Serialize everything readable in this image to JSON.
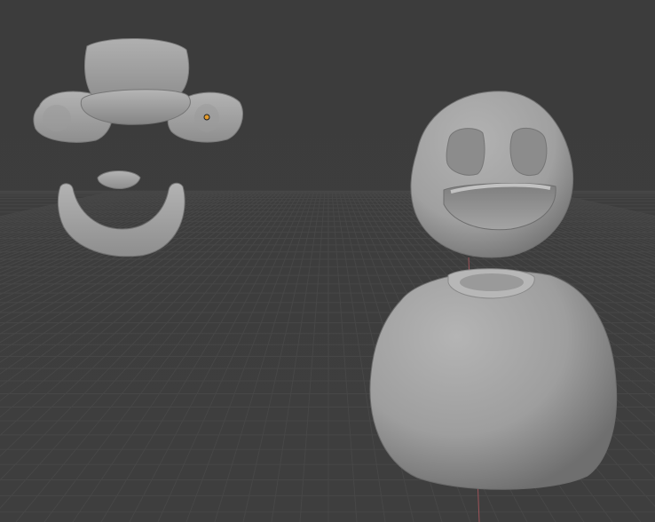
{
  "viewport": {
    "background": "#3d3d3d",
    "grid_color": "#474747",
    "axis_y_color": "#9c5359",
    "mesh_color": "#a6a6a6",
    "origin_color": "#e39a2b"
  },
  "objects": [
    "hat-mesh",
    "left-ear-mesh",
    "right-ear-mesh",
    "nose-mesh",
    "mustache-mesh",
    "head-mesh",
    "body-mesh"
  ],
  "selected_origin_visible": true
}
